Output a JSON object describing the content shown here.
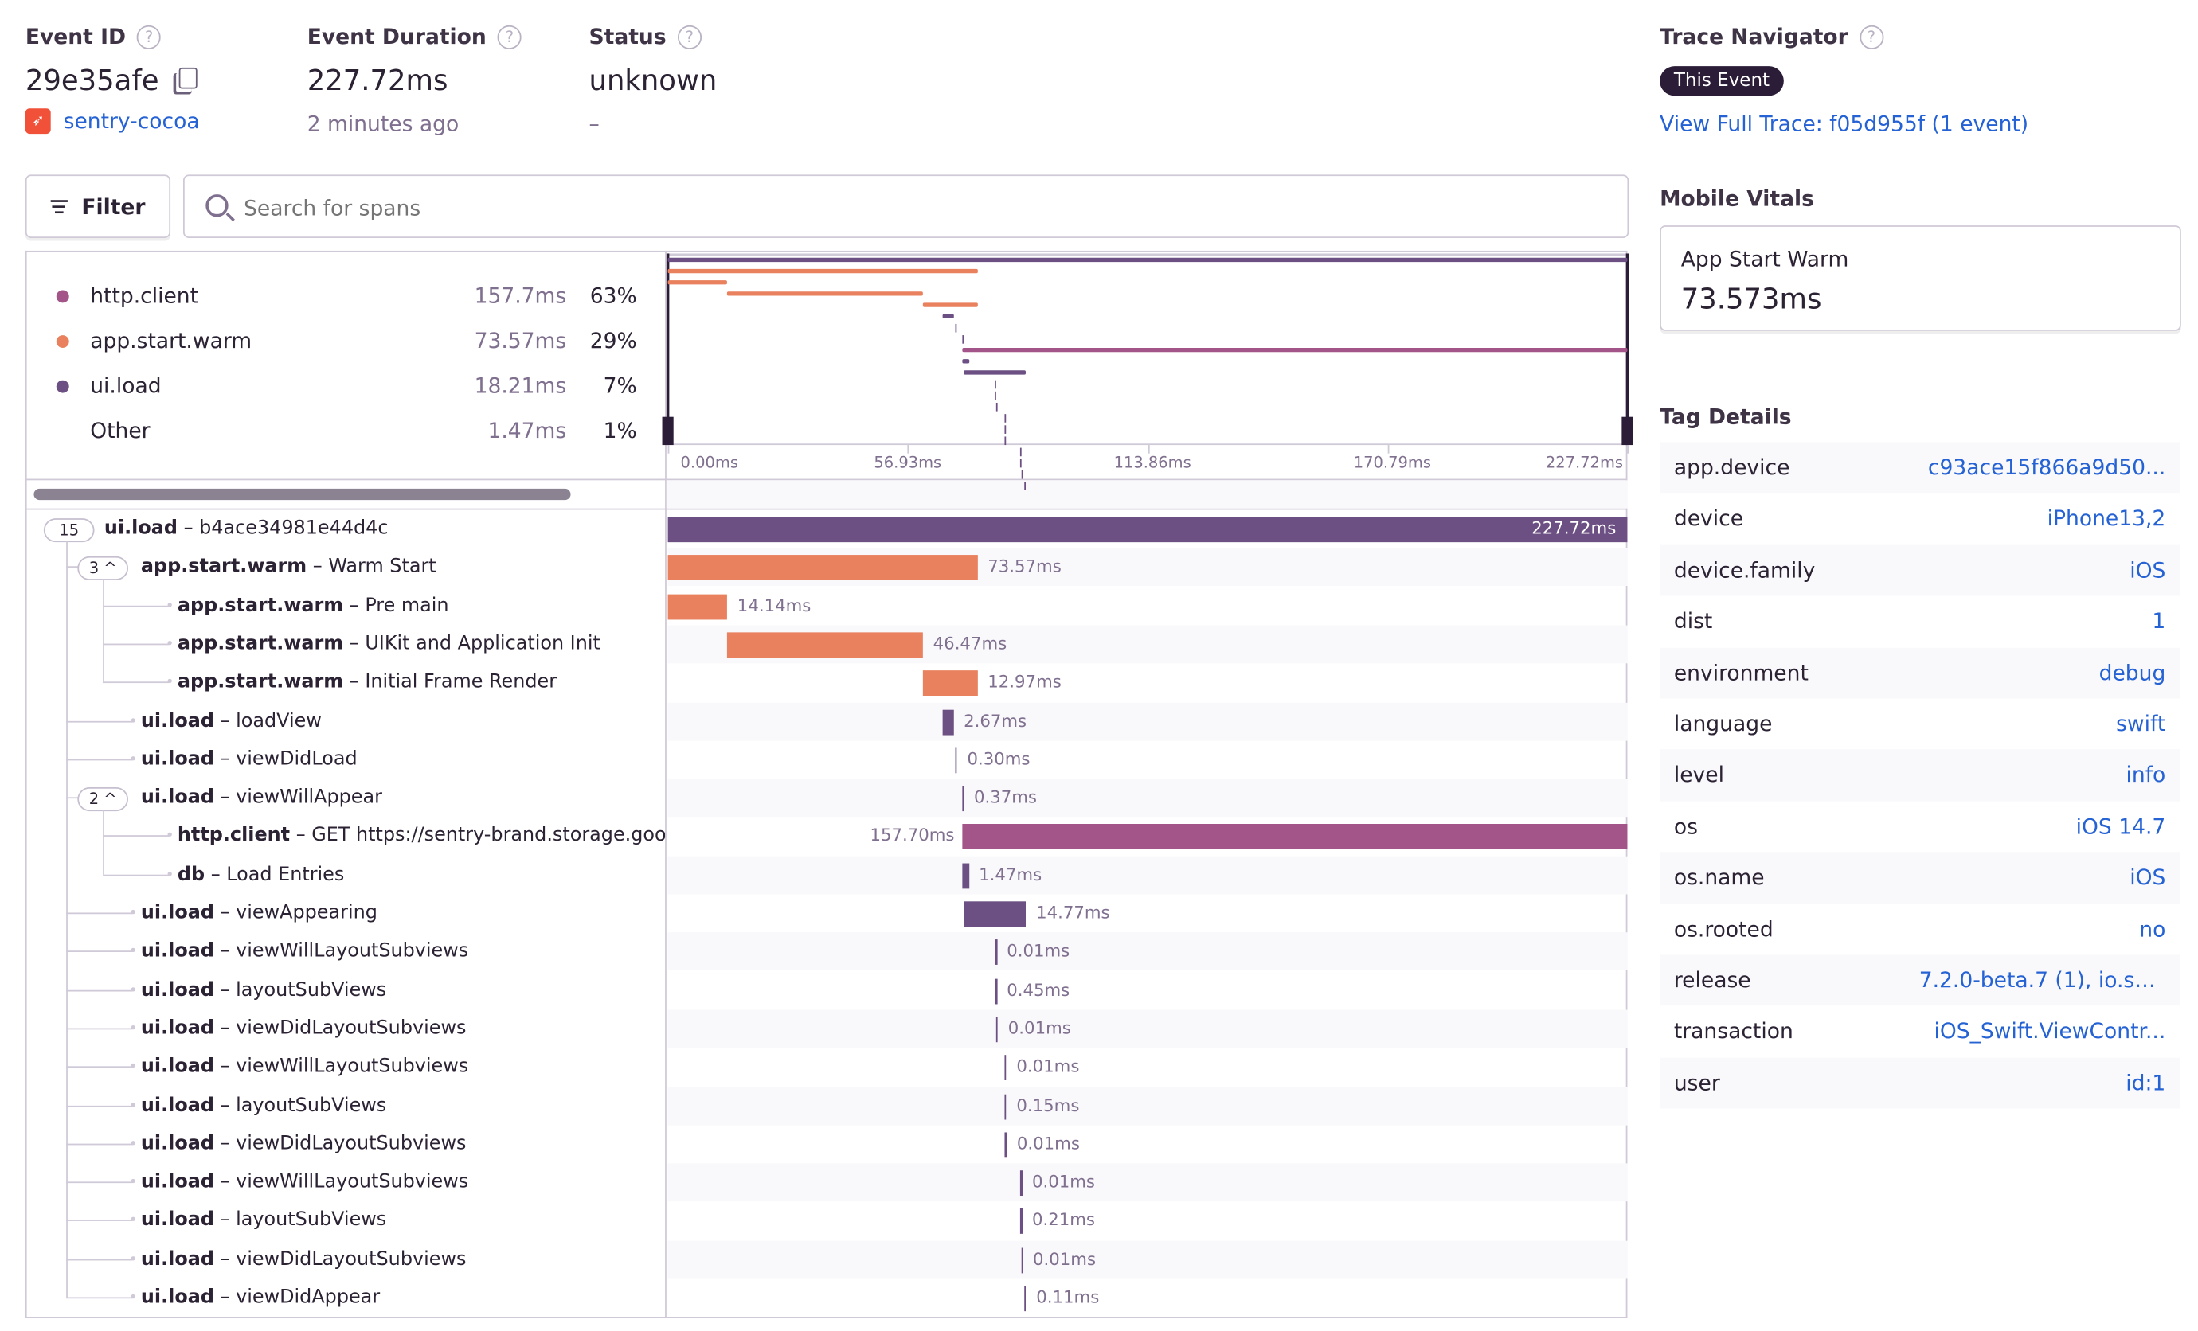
{
  "header": {
    "event_id_label": "Event ID",
    "event_id": "29e35afe",
    "project": "sentry-cocoa",
    "duration_label": "Event Duration",
    "duration": "227.72ms",
    "time_ago": "2 minutes ago",
    "status_label": "Status",
    "status": "unknown",
    "status_sub": "–"
  },
  "trace_navigator": {
    "title": "Trace Navigator",
    "badge": "This Event",
    "link": "View Full Trace: f05d955f (1 event)"
  },
  "toolbar": {
    "filter_label": "Filter",
    "search_placeholder": "Search for spans"
  },
  "colors": {
    "http.client": "#a35488",
    "app.start.warm": "#e9805e",
    "ui.load": "#6c5083",
    "db": "#6c5083",
    "accent": "#2562d4"
  },
  "ops_legend": [
    {
      "op": "http.client",
      "duration": "157.7ms",
      "percent": "63%",
      "color": "#a35488"
    },
    {
      "op": "app.start.warm",
      "duration": "73.57ms",
      "percent": "29%",
      "color": "#e9805e"
    },
    {
      "op": "ui.load",
      "duration": "18.21ms",
      "percent": "7%",
      "color": "#6c5083"
    },
    {
      "op": "Other",
      "duration": "1.47ms",
      "percent": "1%",
      "color": ""
    }
  ],
  "timeline_ticks": [
    "0.00ms",
    "56.93ms",
    "113.86ms",
    "170.79ms",
    "227.72ms"
  ],
  "total_ms": 227.72,
  "spans": [
    {
      "op": "ui.load",
      "desc": "b4ace34981e44d4c",
      "depth": 0,
      "children": "15",
      "start": 0,
      "dur": 227.72,
      "dur_label": "227.72ms"
    },
    {
      "op": "app.start.warm",
      "desc": "Warm Start",
      "depth": 1,
      "children": "3",
      "start": 0,
      "dur": 73.57,
      "dur_label": "73.57ms"
    },
    {
      "op": "app.start.warm",
      "desc": "Pre main",
      "depth": 2,
      "start": 0,
      "dur": 14.14,
      "dur_label": "14.14ms"
    },
    {
      "op": "app.start.warm",
      "desc": "UIKit and Application Init",
      "depth": 2,
      "start": 14.14,
      "dur": 46.47,
      "dur_label": "46.47ms"
    },
    {
      "op": "app.start.warm",
      "desc": "Initial Frame Render",
      "depth": 2,
      "start": 60.61,
      "dur": 12.97,
      "dur_label": "12.97ms"
    },
    {
      "op": "ui.load",
      "desc": "loadView",
      "depth": 1,
      "start": 65.2,
      "dur": 2.67,
      "dur_label": "2.67ms"
    },
    {
      "op": "ui.load",
      "desc": "viewDidLoad",
      "depth": 1,
      "start": 68.2,
      "dur": 0.3,
      "dur_label": "0.30ms"
    },
    {
      "op": "ui.load",
      "desc": "viewWillAppear",
      "depth": 1,
      "children": "2",
      "start": 69.8,
      "dur": 0.37,
      "dur_label": "0.37ms"
    },
    {
      "op": "http.client",
      "desc": "GET https://sentry-brand.storage.googleapis.com",
      "depth": 2,
      "start": 70.02,
      "dur": 157.7,
      "dur_label": "157.70ms"
    },
    {
      "op": "db",
      "desc": "Load Entries",
      "depth": 2,
      "start": 70.0,
      "dur": 1.47,
      "dur_label": "1.47ms"
    },
    {
      "op": "ui.load",
      "desc": "viewAppearing",
      "depth": 1,
      "start": 70.3,
      "dur": 14.77,
      "dur_label": "14.77ms"
    },
    {
      "op": "ui.load",
      "desc": "viewWillLayoutSubviews",
      "depth": 1,
      "start": 77.6,
      "dur": 0.01,
      "dur_label": "0.01ms"
    },
    {
      "op": "ui.load",
      "desc": "layoutSubViews",
      "depth": 1,
      "start": 77.6,
      "dur": 0.45,
      "dur_label": "0.45ms"
    },
    {
      "op": "ui.load",
      "desc": "viewDidLayoutSubviews",
      "depth": 1,
      "start": 77.9,
      "dur": 0.01,
      "dur_label": "0.01ms"
    },
    {
      "op": "ui.load",
      "desc": "viewWillLayoutSubviews",
      "depth": 1,
      "start": 79.9,
      "dur": 0.01,
      "dur_label": "0.01ms"
    },
    {
      "op": "ui.load",
      "desc": "layoutSubViews",
      "depth": 1,
      "start": 79.9,
      "dur": 0.15,
      "dur_label": "0.15ms"
    },
    {
      "op": "ui.load",
      "desc": "viewDidLayoutSubviews",
      "depth": 1,
      "start": 80.0,
      "dur": 0.01,
      "dur_label": "0.01ms"
    },
    {
      "op": "ui.load",
      "desc": "viewWillLayoutSubviews",
      "depth": 1,
      "start": 83.6,
      "dur": 0.01,
      "dur_label": "0.01ms"
    },
    {
      "op": "ui.load",
      "desc": "layoutSubViews",
      "depth": 1,
      "start": 83.6,
      "dur": 0.21,
      "dur_label": "0.21ms"
    },
    {
      "op": "ui.load",
      "desc": "viewDidLayoutSubviews",
      "depth": 1,
      "start": 83.8,
      "dur": 0.01,
      "dur_label": "0.01ms"
    },
    {
      "op": "ui.load",
      "desc": "viewDidAppear",
      "depth": 1,
      "start": 84.6,
      "dur": 0.11,
      "dur_label": "0.11ms"
    }
  ],
  "mobile_vitals": {
    "title": "Mobile Vitals",
    "name": "App Start Warm",
    "value": "73.573ms"
  },
  "tag_details": {
    "title": "Tag Details",
    "tags": [
      {
        "key": "app.device",
        "value": "c93ace15f866a9d50..."
      },
      {
        "key": "device",
        "value": "iPhone13,2"
      },
      {
        "key": "device.family",
        "value": "iOS"
      },
      {
        "key": "dist",
        "value": "1"
      },
      {
        "key": "environment",
        "value": "debug"
      },
      {
        "key": "language",
        "value": "swift"
      },
      {
        "key": "level",
        "value": "info"
      },
      {
        "key": "os",
        "value": "iOS 14.7"
      },
      {
        "key": "os.name",
        "value": "iOS"
      },
      {
        "key": "os.rooted",
        "value": "no"
      },
      {
        "key": "release",
        "value": "7.2.0-beta.7 (1), io.se..."
      },
      {
        "key": "transaction",
        "value": "iOS_Swift.ViewContr..."
      },
      {
        "key": "user",
        "value": "id:1"
      }
    ]
  }
}
